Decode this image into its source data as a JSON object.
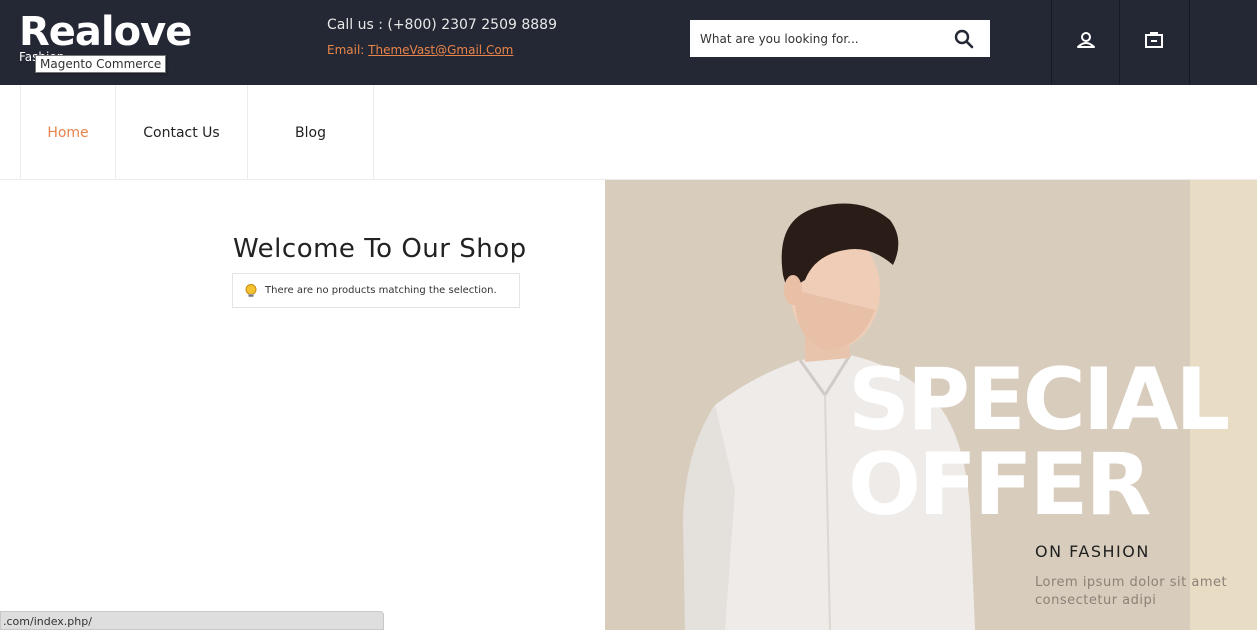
{
  "header": {
    "logo_text": "Realove",
    "logo_sub": "Fashion",
    "tooltip": "Magento Commerce",
    "call_us": "Call us : (+800) 2307 2509 8889",
    "email_label": "Email: ",
    "email_link": "ThemeVast@Gmail.Com",
    "search_placeholder": "What are you looking for...",
    "icons": [
      "search-icon",
      "user-icon",
      "cart-icon"
    ],
    "bg_color": "#232834",
    "accent_color": "#e8834a"
  },
  "nav": {
    "items": [
      {
        "label": "Home",
        "active": true
      },
      {
        "label": "Contact Us",
        "active": false
      },
      {
        "label": "Blog",
        "active": false
      }
    ]
  },
  "main": {
    "title": "Welcome To Our Shop",
    "notice": "There are no products matching the selection."
  },
  "banner": {
    "line1": "SPECIAL",
    "line2": "OFFER",
    "subtitle": "ON FASHION",
    "text": "Lorem ipsum dolor sit amet consectetur adipi"
  },
  "statusbar": {
    "url": ".com/index.php/"
  }
}
